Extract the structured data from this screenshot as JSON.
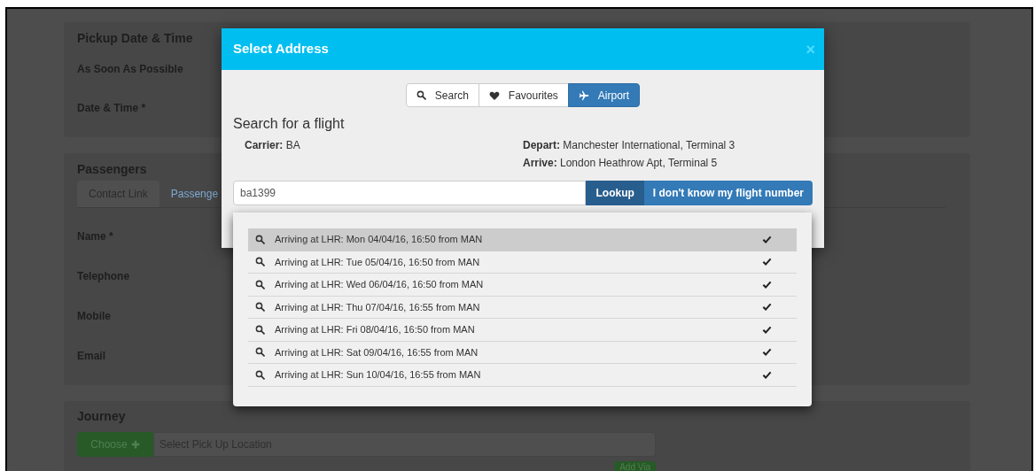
{
  "background_form": {
    "pickup": {
      "title": "Pickup Date & Time",
      "fields": [
        "As Soon As Possible",
        "Date & Time *"
      ]
    },
    "passengers": {
      "title": "Passengers",
      "tabs": [
        {
          "label": "Contact Link",
          "selected": true
        },
        {
          "label": "Passenge",
          "selected": false
        }
      ],
      "fields": [
        "Name *",
        "Telephone",
        "Mobile",
        "Email"
      ]
    },
    "journey": {
      "title": "Journey",
      "choose_button": "Choose",
      "pickup_placeholder": "Select Pick Up Location",
      "add_via_button": "Add Via"
    }
  },
  "modal": {
    "title": "Select Address",
    "close": "×",
    "tabs": [
      {
        "label": "Search",
        "kind": "search",
        "selected": false
      },
      {
        "label": "Favourites",
        "kind": "heart",
        "selected": false
      },
      {
        "label": "Airport",
        "kind": "plane",
        "selected": true
      }
    ],
    "heading": "Search for a flight",
    "details_left": [
      {
        "label": "Carrier:",
        "value": "BA"
      }
    ],
    "details_right": [
      {
        "label": "Depart:",
        "value": "Manchester International, Terminal 3"
      },
      {
        "label": "Arrive:",
        "value": "London Heathrow Apt, Terminal 5"
      }
    ],
    "flight_input": {
      "value": "ba1399"
    },
    "lookup_button": "Lookup",
    "unknown_button": "I don't know my flight number",
    "results": [
      {
        "text": "Arriving at LHR: Mon 04/04/16, 16:50 from MAN",
        "selected": true
      },
      {
        "text": "Arriving at LHR: Tue 05/04/16, 16:50 from MAN",
        "selected": false
      },
      {
        "text": "Arriving at LHR: Wed 06/04/16, 16:50 from MAN",
        "selected": false
      },
      {
        "text": "Arriving at LHR: Thu 07/04/16, 16:55 from MAN",
        "selected": false
      },
      {
        "text": "Arriving at LHR: Fri 08/04/16, 16:50 from MAN",
        "selected": false
      },
      {
        "text": "Arriving at LHR: Sat 09/04/16, 16:55 from MAN",
        "selected": false
      },
      {
        "text": "Arriving at LHR: Sun 10/04/16, 16:55 from MAN",
        "selected": false
      }
    ]
  }
}
